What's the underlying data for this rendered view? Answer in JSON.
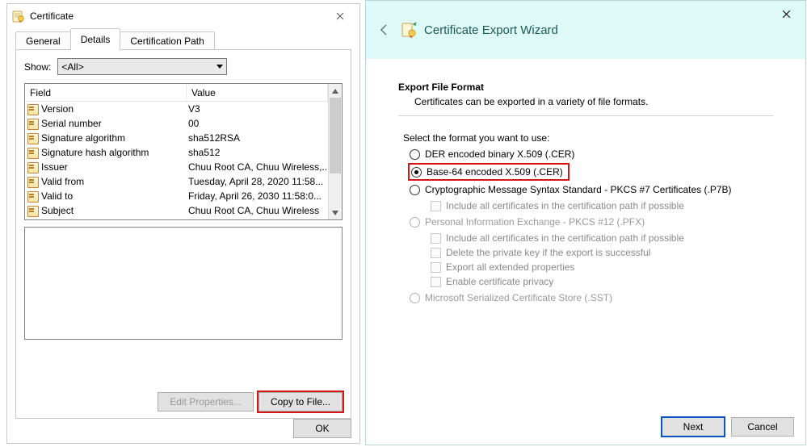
{
  "cert_dialog": {
    "title": "Certificate",
    "tabs": [
      "General",
      "Details",
      "Certification Path"
    ],
    "active_tab": 1,
    "show_label": "Show:",
    "show_value": "<All>",
    "columns": {
      "field": "Field",
      "value": "Value"
    },
    "rows": [
      {
        "field": "Version",
        "value": "V3"
      },
      {
        "field": "Serial number",
        "value": "00"
      },
      {
        "field": "Signature algorithm",
        "value": "sha512RSA"
      },
      {
        "field": "Signature hash algorithm",
        "value": "sha512"
      },
      {
        "field": "Issuer",
        "value": "Chuu Root CA, Chuu Wireless,..."
      },
      {
        "field": "Valid from",
        "value": "Tuesday, April 28, 2020 11:58..."
      },
      {
        "field": "Valid to",
        "value": "Friday, April 26, 2030 11:58:0..."
      },
      {
        "field": "Subject",
        "value": "Chuu Root CA, Chuu Wireless"
      }
    ],
    "edit_btn": "Edit Properties...",
    "copy_btn": "Copy to File...",
    "ok_btn": "OK"
  },
  "wizard": {
    "title": "Certificate Export Wizard",
    "heading": "Export File Format",
    "subheading": "Certificates can be exported in a variety of file formats.",
    "select_label": "Select the format you want to use:",
    "opts": {
      "der": "DER encoded binary X.509 (.CER)",
      "b64": "Base-64 encoded X.509 (.CER)",
      "p7b": "Cryptographic Message Syntax Standard - PKCS #7 Certificates (.P7B)",
      "p7b_inc": "Include all certificates in the certification path if possible",
      "pfx": "Personal Information Exchange - PKCS #12 (.PFX)",
      "pfx_inc": "Include all certificates in the certification path if possible",
      "pfx_del": "Delete the private key if the export is successful",
      "pfx_ext": "Export all extended properties",
      "pfx_priv": "Enable certificate privacy",
      "sst": "Microsoft Serialized Certificate Store (.SST)"
    },
    "next_btn": "Next",
    "cancel_btn": "Cancel"
  }
}
